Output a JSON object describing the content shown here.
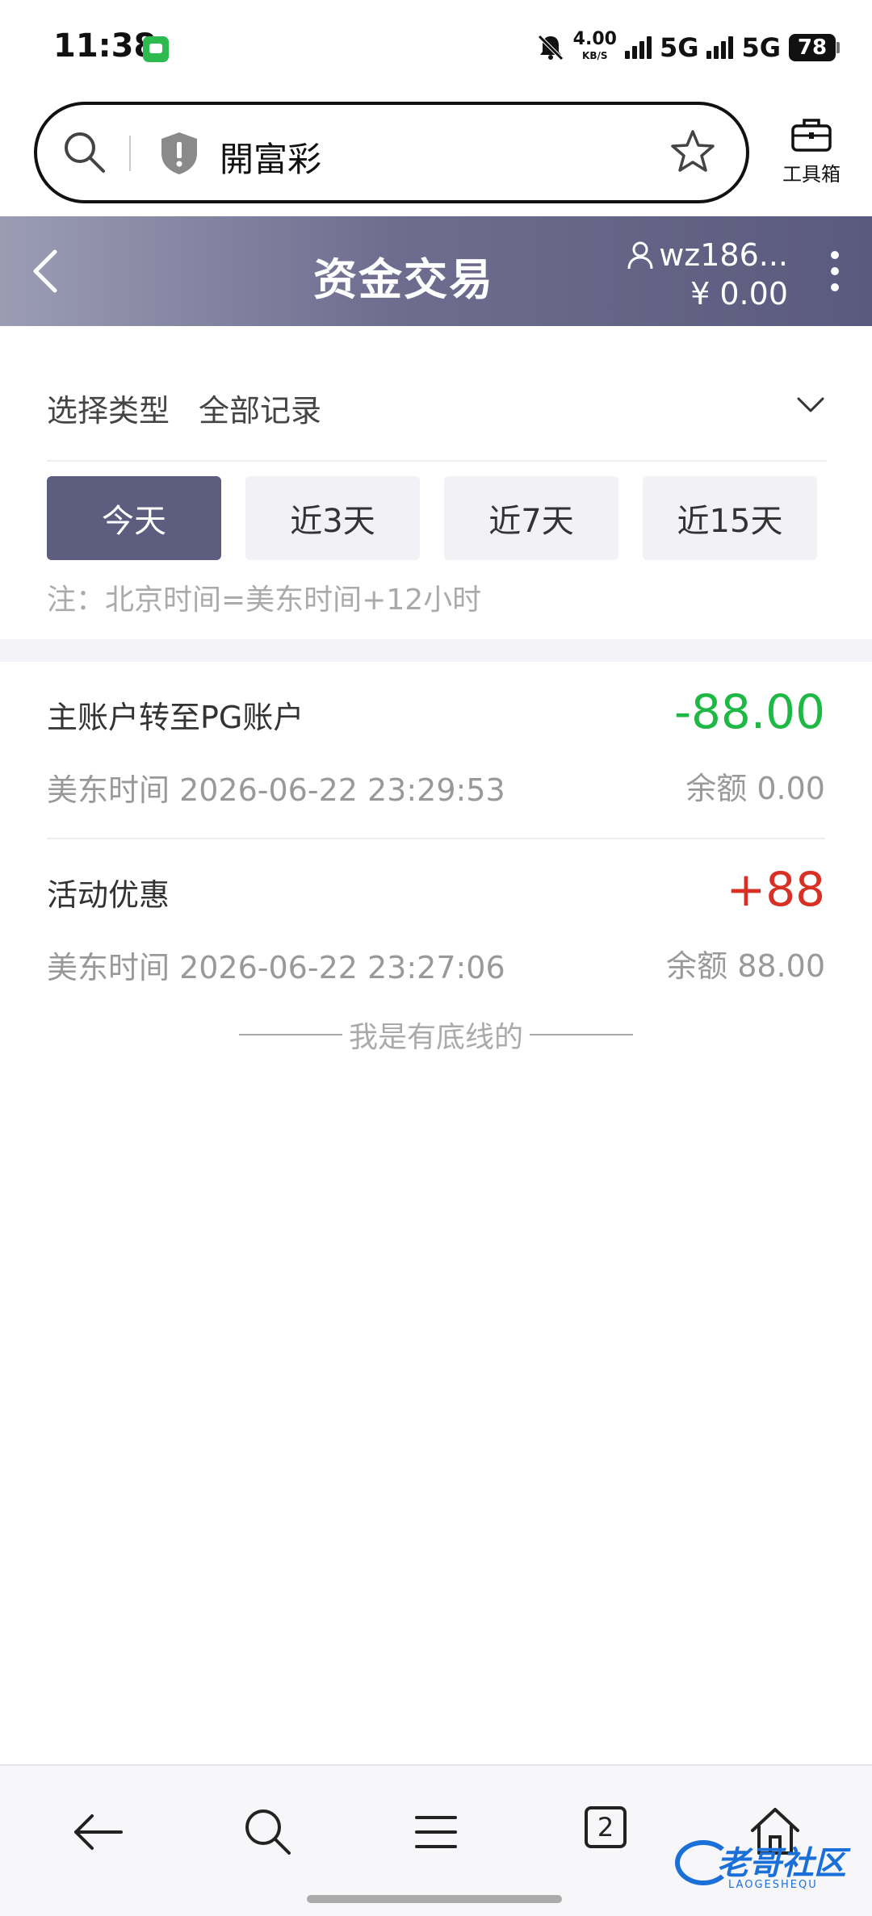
{
  "status": {
    "time": "11:38",
    "net_speed": "4.00",
    "net_speed_unit": "KB/S",
    "network1": "5G",
    "network2": "5G",
    "battery": "78"
  },
  "browser": {
    "url_text": "開富彩",
    "toolbox_label": "工具箱"
  },
  "header": {
    "title": "资金交易",
    "username": "wz186...",
    "balance": "¥ 0.00"
  },
  "filter": {
    "type_label": "选择类型",
    "type_value": "全部记录",
    "tabs": [
      {
        "label": "今天",
        "active": true
      },
      {
        "label": "近3天",
        "active": false
      },
      {
        "label": "近7天",
        "active": false
      },
      {
        "label": "近15天",
        "active": false
      }
    ],
    "note": "注：北京时间=美东时间+12小时"
  },
  "records": [
    {
      "title": "主账户转至PG账户",
      "amount": "-88.00",
      "time": "美东时间 2026-06-22 23:29:53",
      "balance": "余额 0.00"
    },
    {
      "title": "活动优惠",
      "amount": "+88",
      "time": "美东时间 2026-06-22 23:27:06",
      "balance": "余额 88.00"
    }
  ],
  "end_text": "我是有底线的",
  "bottom_nav": {
    "tab_count": "2"
  },
  "watermark": {
    "text": "老哥社区",
    "sub": "LAOGESHEQU"
  },
  "colors": {
    "header_accent": "#5d5d80",
    "negative_amount": "#1eb845",
    "positive_amount": "#d93025"
  }
}
